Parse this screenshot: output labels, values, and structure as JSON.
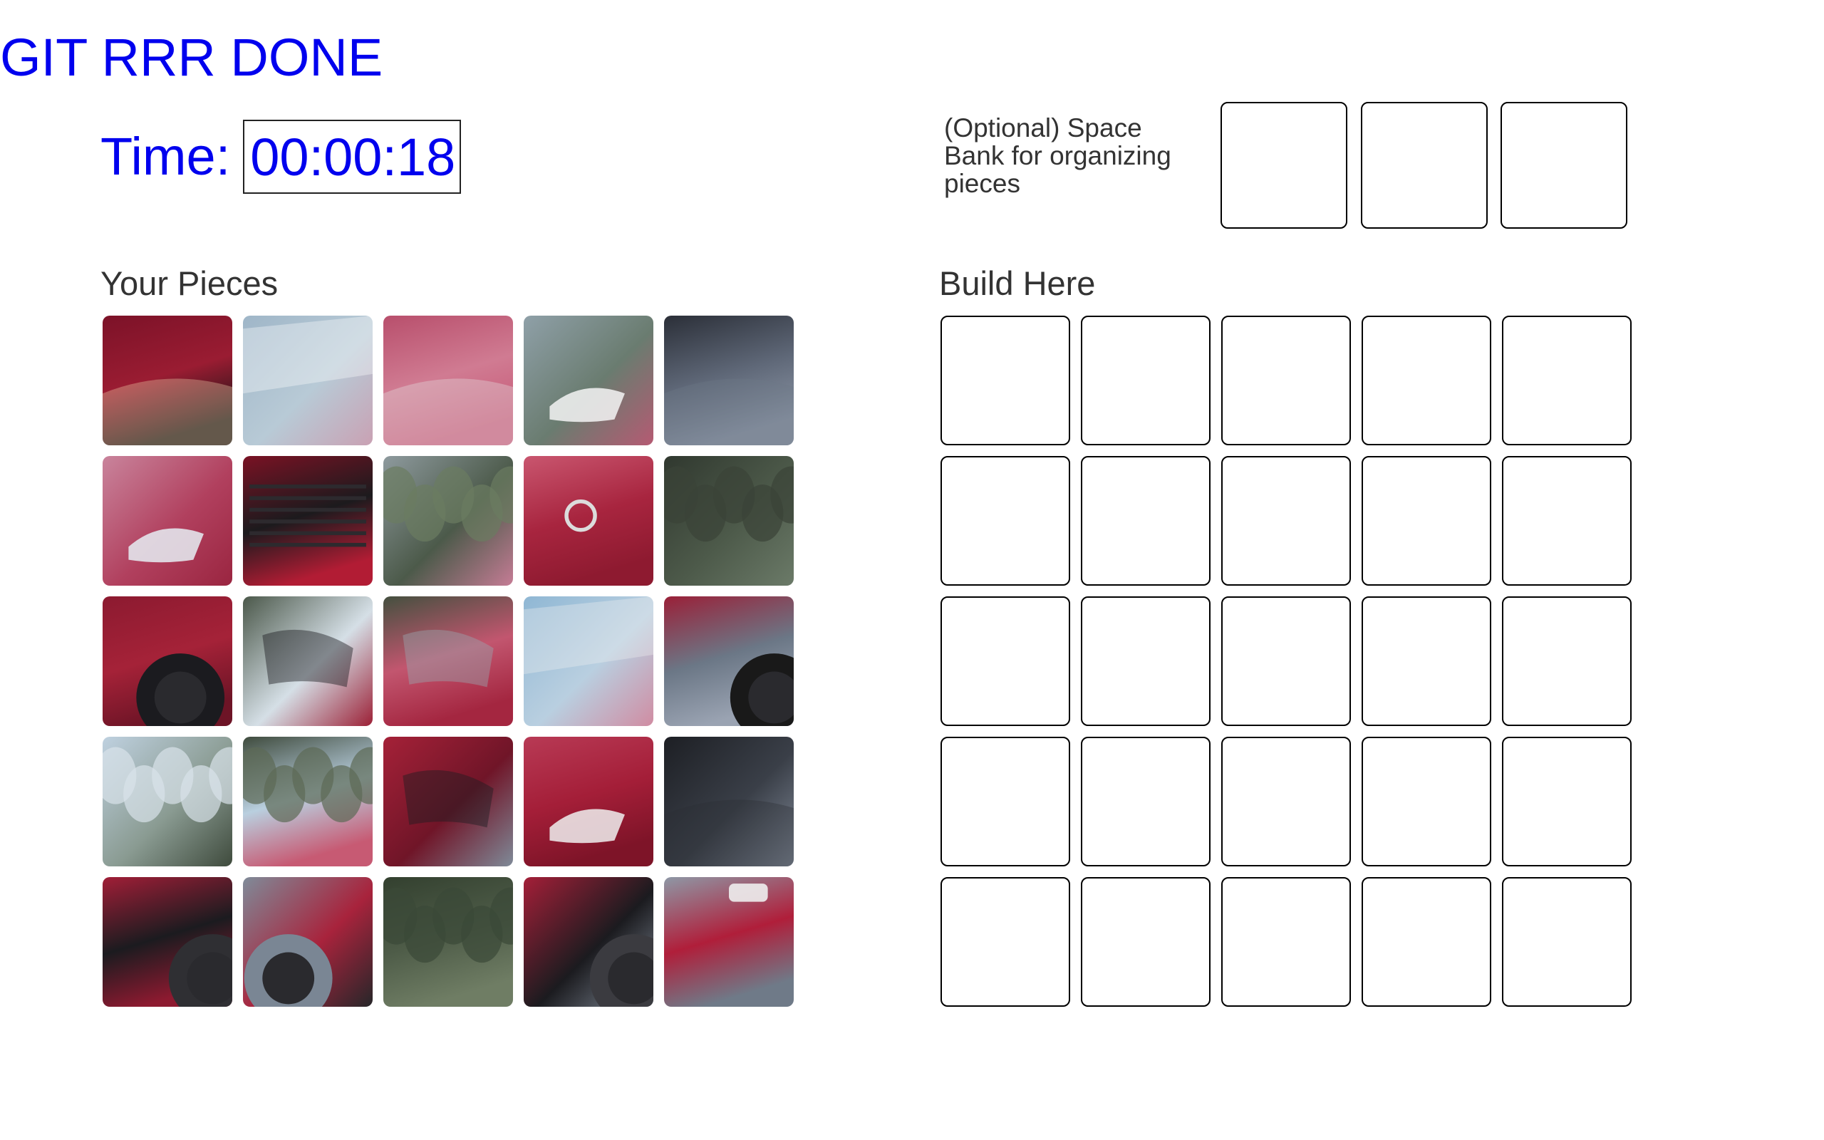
{
  "header": {
    "title": "GIT RRR DONE",
    "time_label": "Time:",
    "time_value": "00:00:18"
  },
  "space_bank": {
    "label": "(Optional) Space Bank for organizing pieces",
    "slot_count": 3
  },
  "pieces_section": {
    "heading": "Your Pieces",
    "rows": 5,
    "cols": 5,
    "pieces": [
      {
        "id": "r1c1",
        "top": "#7c1228",
        "mid": "#9a1c32",
        "bot": "#1a1416",
        "accent": "#f2d8b0",
        "scene": "red-body-dark"
      },
      {
        "id": "r1c2",
        "top": "#9fb6c8",
        "mid": "#b8cad6",
        "bot": "#c9a1b3",
        "accent": "#ffffff",
        "scene": "windshield"
      },
      {
        "id": "r1c3",
        "top": "#b84f6c",
        "mid": "#d07b92",
        "bot": "#c75a78",
        "accent": "#e6e6e6",
        "scene": "hood"
      },
      {
        "id": "r1c4",
        "top": "#8fa0a8",
        "mid": "#6a7c70",
        "bot": "#b55a72",
        "accent": "#f4f4f4",
        "scene": "road-car-corner"
      },
      {
        "id": "r1c5",
        "top": "#2b2f38",
        "mid": "#5f6878",
        "bot": "#8a94a4",
        "accent": "#6e7787",
        "scene": "asphalt"
      },
      {
        "id": "r2c1",
        "top": "#c9849c",
        "mid": "#b1405e",
        "bot": "#9a2540",
        "accent": "#e6eef5",
        "scene": "headlight"
      },
      {
        "id": "r2c2",
        "top": "#7a1224",
        "mid": "#1c1a1d",
        "bot": "#b21c34",
        "accent": "#2d2a2e",
        "scene": "grille"
      },
      {
        "id": "r2c3",
        "top": "#8e9a9e",
        "mid": "#4c5a4a",
        "bot": "#c57c95",
        "accent": "#6b7c61",
        "scene": "trees-hood"
      },
      {
        "id": "r2c4",
        "top": "#c9566f",
        "mid": "#a8253f",
        "bot": "#8e1a30",
        "accent": "#dcdcdc",
        "scene": "badge"
      },
      {
        "id": "r2c5",
        "top": "#30382f",
        "mid": "#4d5a4a",
        "bot": "#6b7a68",
        "accent": "#3a4338",
        "scene": "trees"
      },
      {
        "id": "r3c1",
        "top": "#8c1a30",
        "mid": "#a52238",
        "bot": "#6d1426",
        "accent": "#1b1b1f",
        "scene": "wheel-arch"
      },
      {
        "id": "r3c2",
        "top": "#4b584a",
        "mid": "#d5dfe6",
        "bot": "#9c2036",
        "accent": "#1d1d22",
        "scene": "mirror"
      },
      {
        "id": "r3c3",
        "top": "#44503f",
        "mid": "#c2566f",
        "bot": "#a42640",
        "accent": "#9aa4ac",
        "scene": "door"
      },
      {
        "id": "r3c4",
        "top": "#8fb7d4",
        "mid": "#b9cfe0",
        "bot": "#d08ca2",
        "accent": "#f2f2f2",
        "scene": "roof-sky"
      },
      {
        "id": "r3c5",
        "top": "#9a2038",
        "mid": "#6b7786",
        "bot": "#9aa3b2",
        "accent": "#191919",
        "scene": "rear-wheel-road"
      },
      {
        "id": "r4c1",
        "top": "#bfd1e0",
        "mid": "#8a9b92",
        "bot": "#3f4b3d",
        "accent": "#d8e2ea",
        "scene": "sky-trees"
      },
      {
        "id": "r4c2",
        "top": "#3f4b3d",
        "mid": "#b9cfdf",
        "bot": "#c75a73",
        "accent": "#5c6a56",
        "scene": "windshield-trees"
      },
      {
        "id": "r4c3",
        "top": "#a52138",
        "mid": "#701528",
        "bot": "#7f8a98",
        "accent": "#1d1d21",
        "scene": "side-skirt"
      },
      {
        "id": "r4c4",
        "top": "#b83a55",
        "mid": "#a41e38",
        "bot": "#7e1428",
        "accent": "#f0f0f0",
        "scene": "front-bumper"
      },
      {
        "id": "r4c5",
        "top": "#1d1f24",
        "mid": "#3a3f48",
        "bot": "#818a98",
        "accent": "#2a2d33",
        "scene": "shadow-road"
      },
      {
        "id": "r5c1",
        "top": "#a11e37",
        "mid": "#1b1b1f",
        "bot": "#8d1a30",
        "accent": "#2f2f33",
        "scene": "front-wheel"
      },
      {
        "id": "r5c2",
        "top": "#7f8b99",
        "mid": "#a8233c",
        "bot": "#262629",
        "accent": "#7a8694",
        "scene": "tire-road"
      },
      {
        "id": "r5c3",
        "top": "#33402f",
        "mid": "#4e5c48",
        "bot": "#6f7d64",
        "accent": "#3b4837",
        "scene": "trees-dark"
      },
      {
        "id": "r5c4",
        "top": "#a41f38",
        "mid": "#1b1b1f",
        "bot": "#858f9c",
        "accent": "#3b3b40",
        "scene": "rear-wheel"
      },
      {
        "id": "r5c5",
        "top": "#8e98a6",
        "mid": "#b01e3a",
        "bot": "#6f7a88",
        "accent": "#eeeeee",
        "scene": "taillight"
      }
    ]
  },
  "build_section": {
    "heading": "Build Here",
    "rows": 5,
    "cols": 5
  }
}
